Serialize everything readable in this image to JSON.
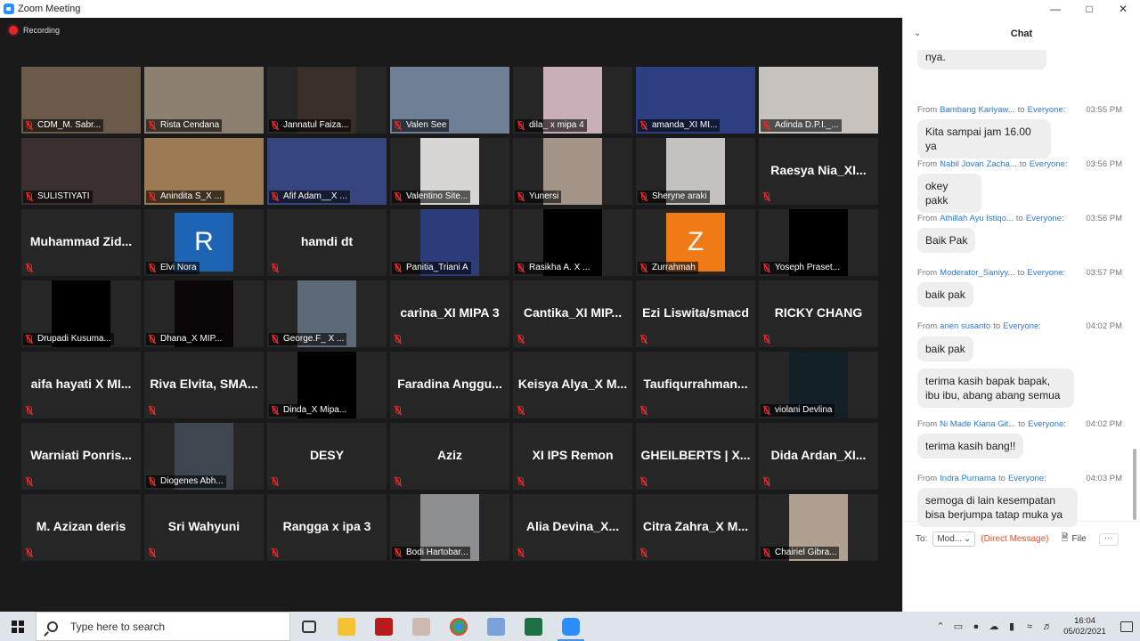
{
  "window": {
    "title": "Zoom Meeting"
  },
  "recording": "Recording",
  "tiles": [
    {
      "name": "CDM_M. Sabr...",
      "kind": "video",
      "color": "#6b5a4a"
    },
    {
      "name": "Rista Cendana",
      "kind": "video",
      "color": "#8c8070"
    },
    {
      "name": "Jannatul Faiza...",
      "kind": "video",
      "color": "#3a2e28",
      "narrow": true
    },
    {
      "name": "Valen See",
      "kind": "video",
      "color": "#6e7f96"
    },
    {
      "name": "dila_ x mipa 4",
      "kind": "video",
      "color": "#c9b0b8",
      "narrow": true
    },
    {
      "name": "amanda_XI MI...",
      "kind": "video",
      "color": "#2d3f80"
    },
    {
      "name": "Adinda D.P.I._...",
      "kind": "video",
      "color": "#c8c2bf"
    },
    {
      "name": "SULISTIYATI",
      "kind": "video",
      "color": "#3b3030"
    },
    {
      "name": "Anindita S_X ...",
      "kind": "video",
      "color": "#9c7a54"
    },
    {
      "name": "Afif Adam__X ...",
      "kind": "video",
      "color": "#36457e"
    },
    {
      "name": "Valentino Site...",
      "kind": "video",
      "color": "#d8d6d4",
      "narrow": true
    },
    {
      "name": "Yunersi",
      "kind": "video",
      "color": "#a49488",
      "narrow": true
    },
    {
      "name": "Sheryne araki",
      "kind": "video",
      "color": "#c4c2c0",
      "narrow": true
    },
    {
      "name": "Raesya  Nia_XI...",
      "kind": "text"
    },
    {
      "name": "Muhammad  Zid...",
      "kind": "text"
    },
    {
      "name": "Elvi Nora",
      "kind": "avatar",
      "letter": "R",
      "color": "#1e64b4"
    },
    {
      "name": "hamdi dt",
      "kind": "text"
    },
    {
      "name": "Panitia_Triani A",
      "kind": "video",
      "color": "#2c3c7a",
      "narrow": true
    },
    {
      "name": "Rasikha A. X ...",
      "kind": "video",
      "color": "#000000",
      "narrow": true
    },
    {
      "name": "Zurrahmah",
      "kind": "avatar",
      "letter": "Z",
      "color": "#f07a14"
    },
    {
      "name": "Yoseph Praset...",
      "kind": "video",
      "color": "#000000",
      "narrow": true
    },
    {
      "name": "Drupadi Kusuma...",
      "kind": "video",
      "color": "#000000",
      "narrow": true
    },
    {
      "name": "Dhana_X MIP...",
      "kind": "video",
      "color": "#0b0708",
      "narrow": true
    },
    {
      "name": "George.F_ X ...",
      "kind": "video",
      "color": "#5c6a78",
      "narrow": true
    },
    {
      "name": "carina_XI MIPA 3",
      "kind": "text"
    },
    {
      "name": "Cantika_XI  MIP...",
      "kind": "text"
    },
    {
      "name": "Ezi Liswita/smacd",
      "kind": "text"
    },
    {
      "name": "RICKY CHANG",
      "kind": "text"
    },
    {
      "name": "aifa  hayati  X  MI...",
      "kind": "text"
    },
    {
      "name": "Riva  Elvita,  SMA...",
      "kind": "text"
    },
    {
      "name": "Dinda_X Mipa...",
      "kind": "video",
      "color": "#000000",
      "narrow": true
    },
    {
      "name": "Faradina  Anggu...",
      "kind": "text"
    },
    {
      "name": "Keisya  Alya_X  M...",
      "kind": "text"
    },
    {
      "name": "Taufiqurrahman...",
      "kind": "text"
    },
    {
      "name": "violani Devlina",
      "kind": "video",
      "color": "#142028",
      "narrow": true
    },
    {
      "name": "Warniati  Ponris...",
      "kind": "text"
    },
    {
      "name": "Diogenes Abh...",
      "kind": "video",
      "color": "#3e4650",
      "narrow": true
    },
    {
      "name": "DESY",
      "kind": "text"
    },
    {
      "name": "Aziz",
      "kind": "text"
    },
    {
      "name": "XI IPS Remon",
      "kind": "text"
    },
    {
      "name": "GHEILBERTS | X...",
      "kind": "text"
    },
    {
      "name": "Dida  Ardan_XI...",
      "kind": "text"
    },
    {
      "name": "M. Azizan deris",
      "kind": "text"
    },
    {
      "name": "Sri Wahyuni",
      "kind": "text"
    },
    {
      "name": "Rangga x ipa 3",
      "kind": "text"
    },
    {
      "name": "Bodi Hartobar...",
      "kind": "video",
      "color": "#8e8f90",
      "narrow": true
    },
    {
      "name": "Alia  Devina_X...",
      "kind": "text"
    },
    {
      "name": "Citra  Zahra_X  M...",
      "kind": "text"
    },
    {
      "name": "Chairiel Gibra...",
      "kind": "video",
      "color": "#b0a092",
      "narrow": true
    }
  ],
  "chat": {
    "title": "Chat",
    "partial_text": "nya.",
    "messages": [
      {
        "from": "From",
        "sender": "Bambang Kariyaw...",
        "to": "to",
        "recipient": "Everyone:",
        "time": "03:55 PM",
        "texts": [
          "Kita sampai jam 16.00 ya"
        ]
      },
      {
        "from": "From",
        "sender": "Nabil Jovan Zacha...",
        "to": "to",
        "recipient": "Everyone:",
        "time": "03:56 PM",
        "texts": [
          "okey pakk"
        ]
      },
      {
        "from": "From",
        "sender": "Athillah Ayu Istiqo...",
        "to": "to",
        "recipient": "Everyone:",
        "time": "03:56 PM",
        "texts": [
          "Baik Pak"
        ]
      },
      {
        "from": "From",
        "sender": "Moderator_Saniyy...",
        "to": "to",
        "recipient": "Everyone:",
        "time": "03:57 PM",
        "texts": [
          "baik pak"
        ]
      },
      {
        "from": "From",
        "sender": "anen susanto",
        "to": "to",
        "recipient": "Everyone:",
        "time": "04:02 PM",
        "texts": [
          "baik pak",
          "terima kasih bapak bapak, ibu ibu, abang abang semua"
        ]
      },
      {
        "from": "From",
        "sender": "Ni Made Kiana Git...",
        "to": "to",
        "recipient": "Everyone:",
        "time": "04:02 PM",
        "texts": [
          "terima kasih bang!!"
        ]
      },
      {
        "from": "From",
        "sender": "Indra Purnama",
        "to": "to",
        "recipient": "Everyone:",
        "time": "04:03 PM",
        "texts": [
          "semoga di lain kesempatan bisa berjumpa tatap muka ya"
        ]
      }
    ],
    "footer": {
      "to_label": "To:",
      "recipient": "Mod...",
      "direct": "(Direct Message)",
      "file": "File",
      "more": "···"
    }
  },
  "taskbar": {
    "search_placeholder": "Type here to search",
    "time": "16:04",
    "date": "05/02/2021"
  }
}
